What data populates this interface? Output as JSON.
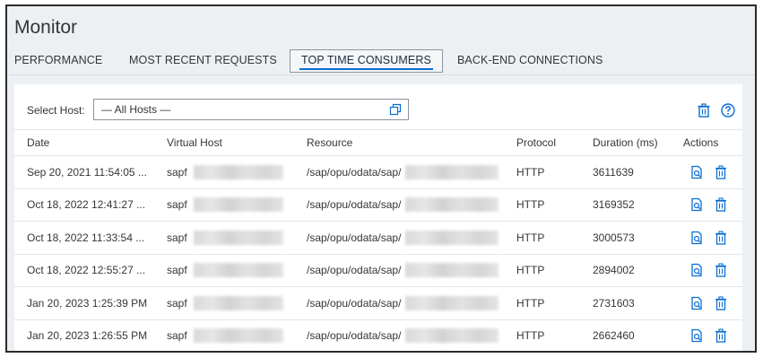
{
  "app": {
    "title": "Monitor"
  },
  "tabs": [
    {
      "label": "PERFORMANCE",
      "selected": false
    },
    {
      "label": "MOST RECENT REQUESTS",
      "selected": false
    },
    {
      "label": "TOP TIME CONSUMERS",
      "selected": true
    },
    {
      "label": "BACK-END CONNECTIONS",
      "selected": false
    }
  ],
  "toolbar": {
    "host_label": "Select Host:",
    "host_value": "— All Hosts —",
    "icons": [
      "trash-icon",
      "help-icon"
    ]
  },
  "table": {
    "headers": [
      "Date",
      "Virtual Host",
      "Resource",
      "Protocol",
      "Duration (ms)",
      "Actions"
    ],
    "rows": [
      {
        "date": "Sep 20, 2021 11:54:05 ...",
        "host": "sapf",
        "resource": "/sap/opu/odata/sap/",
        "protocol": "HTTP",
        "duration": "3611639"
      },
      {
        "date": "Oct 18, 2022 12:41:27 ...",
        "host": "sapf",
        "resource": "/sap/opu/odata/sap/",
        "protocol": "HTTP",
        "duration": "3169352"
      },
      {
        "date": "Oct 18, 2022 11:33:54 ...",
        "host": "sapf",
        "resource": "/sap/opu/odata/sap/",
        "protocol": "HTTP",
        "duration": "3000573"
      },
      {
        "date": "Oct 18, 2022 12:55:27 ...",
        "host": "sapf",
        "resource": "/sap/opu/odata/sap/",
        "protocol": "HTTP",
        "duration": "2894002"
      },
      {
        "date": "Jan 20, 2023 1:25:39 PM",
        "host": "sapf",
        "resource": "/sap/opu/odata/sap/",
        "protocol": "HTTP",
        "duration": "2731603"
      },
      {
        "date": "Jan 20, 2023 1:26:55 PM",
        "host": "sapf",
        "resource": "/sap/opu/odata/sap/",
        "protocol": "HTTP",
        "duration": "2662460"
      }
    ],
    "action_icons": [
      "inspect-icon",
      "delete-icon"
    ]
  },
  "colors": {
    "accent": "#0a6ed1",
    "icon": "#0a6ed1",
    "background": "#edf0f3"
  }
}
